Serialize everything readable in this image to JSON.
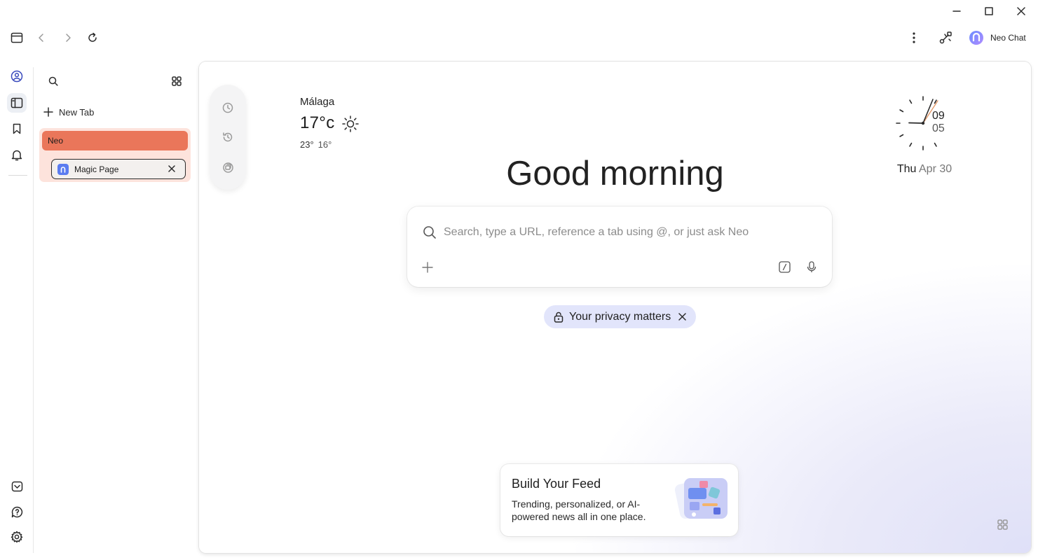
{
  "browser": {
    "toolbar": {
      "neo_chat_label": "Neo Chat",
      "icons": [
        "sidebar-toggle-icon",
        "back-icon",
        "forward-icon",
        "reload-icon",
        "more-icon",
        "tools-icon",
        "neo-logo-icon"
      ]
    },
    "window_controls": [
      "minimize-icon",
      "maximize-icon",
      "close-icon"
    ]
  },
  "rail": {
    "top_icons": [
      "account-icon",
      "tabs-panel-icon",
      "bookmark-icon",
      "bell-icon"
    ],
    "bottom_icons": [
      "pocket-icon",
      "help-icon",
      "settings-icon"
    ]
  },
  "tab_panel": {
    "new_tab_label": "New Tab",
    "group": {
      "name": "Neo",
      "color": "#ea765a",
      "tabs": [
        {
          "title": "Magic Page"
        }
      ]
    }
  },
  "new_tab_page": {
    "weather": {
      "city": "Málaga",
      "temperature": "17°c",
      "high": "23°",
      "low": "16°",
      "condition_icon": "sun-icon"
    },
    "greeting": "Good morning",
    "search": {
      "placeholder": "Search, type a URL, reference a tab using @, or just ask Neo",
      "value": ""
    },
    "privacy_chip": "Your privacy matters",
    "clock": {
      "hour": "09",
      "minute": "05",
      "day": "Thu",
      "date": "Apr 30"
    },
    "feed_card": {
      "title": "Build Your Feed",
      "description": "Trending, personalized, or AI-powered news all in one place."
    },
    "side_actions": [
      "history-icon",
      "recent-icon",
      "collections-icon"
    ],
    "colors": {
      "accent": "#5b7cf0",
      "group_orange": "#ea765a",
      "privacy_chip_bg": "#e2e5fb"
    }
  }
}
